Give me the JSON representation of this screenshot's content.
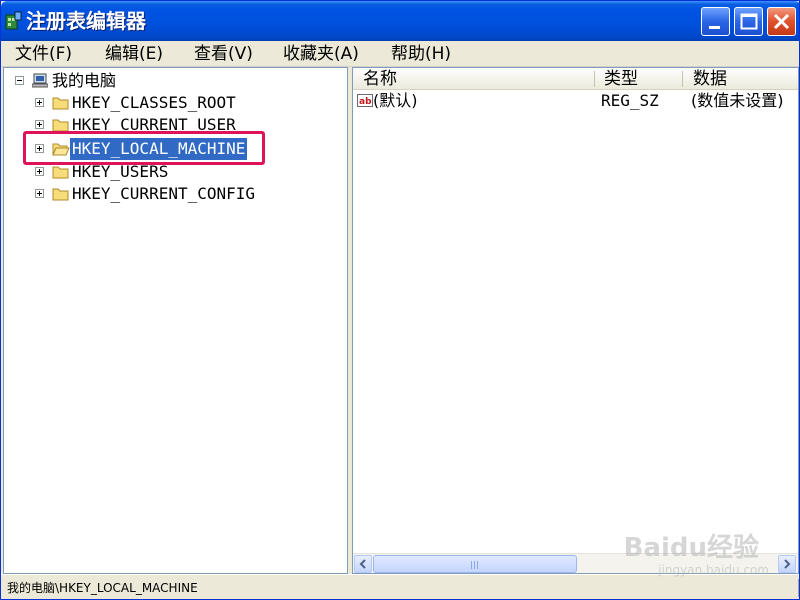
{
  "window": {
    "title": "注册表编辑器",
    "buttons": {
      "minimize": "minimize-button",
      "maximize": "maximize-button",
      "close": "close-button"
    }
  },
  "menu": [
    {
      "label": "文件(F)"
    },
    {
      "label": "编辑(E)"
    },
    {
      "label": "查看(V)"
    },
    {
      "label": "收藏夹(A)"
    },
    {
      "label": "帮助(H)"
    }
  ],
  "tree": {
    "root": {
      "label": "我的电脑",
      "icon": "computer-icon",
      "expanded": true
    },
    "items": [
      {
        "label": "HKEY_CLASSES_ROOT",
        "icon": "folder-icon",
        "selected": false
      },
      {
        "label": "HKEY_CURRENT_USER",
        "icon": "folder-icon",
        "selected": false
      },
      {
        "label": "HKEY_LOCAL_MACHINE",
        "icon": "folder-open-icon",
        "selected": true
      },
      {
        "label": "HKEY_USERS",
        "icon": "folder-icon",
        "selected": false
      },
      {
        "label": "HKEY_CURRENT_CONFIG",
        "icon": "folder-icon",
        "selected": false
      }
    ]
  },
  "list": {
    "columns": [
      "名称",
      "类型",
      "数据"
    ],
    "rows": [
      {
        "name": "(默认)",
        "type": "REG_SZ",
        "data": "(数值未设置)",
        "icon": "string-value-icon"
      }
    ]
  },
  "status": {
    "path": "我的电脑\\HKEY_LOCAL_MACHINE"
  },
  "watermark": {
    "brand": "Baidu经验",
    "url": "jingyan.baidu.com"
  },
  "colors": {
    "selection": "#316ac5",
    "highlight_box": "#e0135a",
    "titlebar": "#0054e3"
  }
}
